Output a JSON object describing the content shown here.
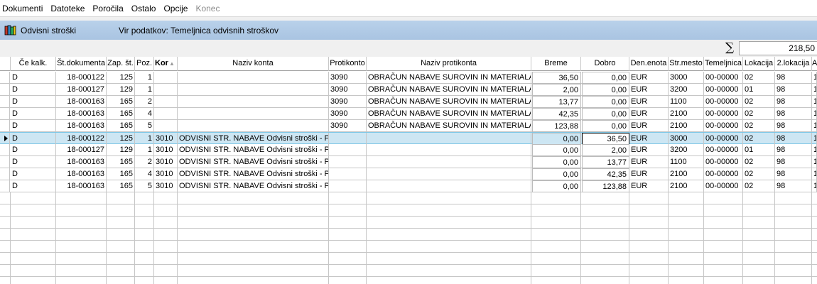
{
  "menu": [
    "Dokumenti",
    "Datoteke",
    "Poročila",
    "Ostalo",
    "Opcije",
    "Konec"
  ],
  "title": "Odvisni stroški",
  "source": "Vir podatkov: Temeljnica odvisnih stroškov",
  "sum": "218,50",
  "sum_symbol": "∑",
  "columns": {
    "ce_kalk": "Če kalk.",
    "st_dok": "Št.dokumenta",
    "zap_st": "Zap. št.",
    "poz": "Poz.",
    "kor": "Kor",
    "naziv_konta": "Naziv konta",
    "protikonto": "Protikonto",
    "naziv_protikonta": "Naziv protikonta",
    "breme": "Breme",
    "dobro": "Dobro",
    "den_enota": "Den.enota",
    "str_mesto": "Str.mesto",
    "temeljnica": "Temeljnica",
    "lokacija": "Lokacija",
    "lokacija2": "2.lokacija",
    "extra": "A"
  },
  "rows": [
    {
      "ce_kalk": "D",
      "st_dok": "18-000122",
      "zap_st": "125",
      "poz": "1",
      "kor": "",
      "naziv_konta": "",
      "protikonto": "3090",
      "naziv_protikonta": "OBRAČUN NABAVE SUROVIN IN MATERIALA",
      "breme": "36,50",
      "dobro": "0,00",
      "den_enota": "EUR",
      "str_mesto": "3000",
      "temeljnica": "00-00000",
      "lokacija": "02",
      "lokacija2": "98",
      "extra": "1"
    },
    {
      "ce_kalk": "D",
      "st_dok": "18-000127",
      "zap_st": "129",
      "poz": "1",
      "kor": "",
      "naziv_konta": "",
      "protikonto": "3090",
      "naziv_protikonta": "OBRAČUN NABAVE SUROVIN IN MATERIALA",
      "breme": "2,00",
      "dobro": "0,00",
      "den_enota": "EUR",
      "str_mesto": "3200",
      "temeljnica": "00-00000",
      "lokacija": "01",
      "lokacija2": "98",
      "extra": "1"
    },
    {
      "ce_kalk": "D",
      "st_dok": "18-000163",
      "zap_st": "165",
      "poz": "2",
      "kor": "",
      "naziv_konta": "",
      "protikonto": "3090",
      "naziv_protikonta": "OBRAČUN NABAVE SUROVIN IN MATERIALA",
      "breme": "13,77",
      "dobro": "0,00",
      "den_enota": "EUR",
      "str_mesto": "1100",
      "temeljnica": "00-00000",
      "lokacija": "02",
      "lokacija2": "98",
      "extra": "1"
    },
    {
      "ce_kalk": "D",
      "st_dok": "18-000163",
      "zap_st": "165",
      "poz": "4",
      "kor": "",
      "naziv_konta": "",
      "protikonto": "3090",
      "naziv_protikonta": "OBRAČUN NABAVE SUROVIN IN MATERIALA",
      "breme": "42,35",
      "dobro": "0,00",
      "den_enota": "EUR",
      "str_mesto": "2100",
      "temeljnica": "00-00000",
      "lokacija": "02",
      "lokacija2": "98",
      "extra": "1"
    },
    {
      "ce_kalk": "D",
      "st_dok": "18-000163",
      "zap_st": "165",
      "poz": "5",
      "kor": "",
      "naziv_konta": "",
      "protikonto": "3090",
      "naziv_protikonta": "OBRAČUN NABAVE SUROVIN IN MATERIALA",
      "breme": "123,88",
      "dobro": "0,00",
      "den_enota": "EUR",
      "str_mesto": "2100",
      "temeljnica": "00-00000",
      "lokacija": "02",
      "lokacija2": "98",
      "extra": "1"
    },
    {
      "ce_kalk": "D",
      "st_dok": "18-000122",
      "zap_st": "125",
      "poz": "1",
      "kor": "3010",
      "naziv_konta": "ODVISNI STR. NABAVE Odvisni stroški - P.",
      "protikonto": "",
      "naziv_protikonta": "",
      "breme": "0,00",
      "dobro": "36,50",
      "den_enota": "EUR",
      "str_mesto": "3000",
      "temeljnica": "00-00000",
      "lokacija": "02",
      "lokacija2": "98",
      "extra": "1"
    },
    {
      "ce_kalk": "D",
      "st_dok": "18-000127",
      "zap_st": "129",
      "poz": "1",
      "kor": "3010",
      "naziv_konta": "ODVISNI STR. NABAVE Odvisni stroški - P.",
      "protikonto": "",
      "naziv_protikonta": "",
      "breme": "0,00",
      "dobro": "2,00",
      "den_enota": "EUR",
      "str_mesto": "3200",
      "temeljnica": "00-00000",
      "lokacija": "01",
      "lokacija2": "98",
      "extra": "1"
    },
    {
      "ce_kalk": "D",
      "st_dok": "18-000163",
      "zap_st": "165",
      "poz": "2",
      "kor": "3010",
      "naziv_konta": "ODVISNI STR. NABAVE Odvisni stroški - P.",
      "protikonto": "",
      "naziv_protikonta": "",
      "breme": "0,00",
      "dobro": "13,77",
      "den_enota": "EUR",
      "str_mesto": "1100",
      "temeljnica": "00-00000",
      "lokacija": "02",
      "lokacija2": "98",
      "extra": "1"
    },
    {
      "ce_kalk": "D",
      "st_dok": "18-000163",
      "zap_st": "165",
      "poz": "4",
      "kor": "3010",
      "naziv_konta": "ODVISNI STR. NABAVE Odvisni stroški - P.",
      "protikonto": "",
      "naziv_protikonta": "",
      "breme": "0,00",
      "dobro": "42,35",
      "den_enota": "EUR",
      "str_mesto": "2100",
      "temeljnica": "00-00000",
      "lokacija": "02",
      "lokacija2": "98",
      "extra": "1"
    },
    {
      "ce_kalk": "D",
      "st_dok": "18-000163",
      "zap_st": "165",
      "poz": "5",
      "kor": "3010",
      "naziv_konta": "ODVISNI STR. NABAVE Odvisni stroški - P.",
      "protikonto": "",
      "naziv_protikonta": "",
      "breme": "0,00",
      "dobro": "123,88",
      "den_enota": "EUR",
      "str_mesto": "2100",
      "temeljnica": "00-00000",
      "lokacija": "02",
      "lokacija2": "98",
      "extra": "1"
    }
  ],
  "selected_row": 5,
  "colors": {
    "selection": "#cde6f3",
    "titlebar": "#b9d1ea",
    "disabled_menu": "#8a8a8a"
  }
}
